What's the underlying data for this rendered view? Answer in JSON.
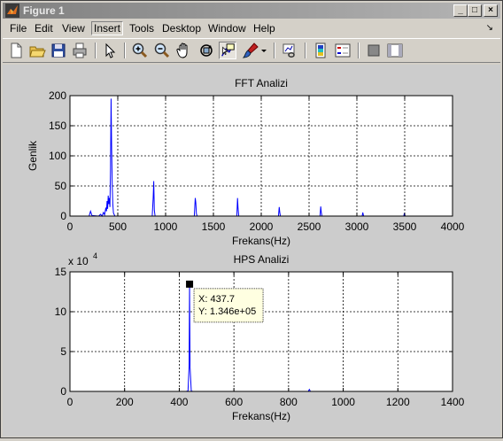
{
  "window": {
    "title": "Figure 1"
  },
  "title_buttons": {
    "minimize": "_",
    "maximize": "□",
    "close": "×"
  },
  "menu": {
    "items": [
      "File",
      "Edit",
      "View",
      "Insert",
      "Tools",
      "Desktop",
      "Window",
      "Help"
    ],
    "active": "Insert",
    "right_icon": "dock-arrow-icon"
  },
  "toolbar": {
    "icons": [
      "new-figure-icon",
      "open-file-icon",
      "save-icon",
      "print-icon",
      "edit-plot-arrow-icon",
      "zoom-in-icon",
      "zoom-out-icon",
      "pan-hand-icon",
      "rotate-3d-icon",
      "data-cursor-icon",
      "brush-icon",
      "brush-dropdown-icon",
      "link-plot-icon",
      "colorbar-icon",
      "legend-icon",
      "hide-plot-tools-icon",
      "show-plot-tools-icon"
    ]
  },
  "colors": {
    "plot_line": "#0000ff",
    "figure_bg": "#cccccc",
    "axes_bg": "#ffffff",
    "datatip_bg": "#ffffe1"
  },
  "chart_data": [
    {
      "type": "line",
      "title": "FFT Analizi",
      "xlabel": "Frekans(Hz)",
      "ylabel": "Genlik",
      "xlim": [
        0,
        4000
      ],
      "ylim": [
        0,
        200
      ],
      "xticks": [
        0,
        500,
        1000,
        1500,
        2000,
        2500,
        3000,
        3500,
        4000
      ],
      "yticks": [
        0,
        50,
        100,
        150,
        200
      ],
      "grid": true,
      "series": [
        {
          "values": [
            [
              0,
              0
            ],
            [
              200,
              0
            ],
            [
              215,
              8
            ],
            [
              230,
              1
            ],
            [
              300,
              0
            ],
            [
              320,
              3
            ],
            [
              335,
              0
            ],
            [
              350,
              6
            ],
            [
              362,
              2
            ],
            [
              375,
              14
            ],
            [
              382,
              8
            ],
            [
              388,
              25
            ],
            [
              394,
              12
            ],
            [
              400,
              34
            ],
            [
              406,
              20
            ],
            [
              412,
              30
            ],
            [
              418,
              15
            ],
            [
              424,
              80
            ],
            [
              430,
              195
            ],
            [
              436,
              110
            ],
            [
              442,
              50
            ],
            [
              448,
              20
            ],
            [
              455,
              5
            ],
            [
              470,
              0
            ],
            [
              860,
              0
            ],
            [
              870,
              30
            ],
            [
              876,
              58
            ],
            [
              882,
              10
            ],
            [
              890,
              0
            ],
            [
              1300,
              0
            ],
            [
              1310,
              30
            ],
            [
              1316,
              22
            ],
            [
              1322,
              4
            ],
            [
              1330,
              0
            ],
            [
              1745,
              0
            ],
            [
              1752,
              30
            ],
            [
              1758,
              12
            ],
            [
              1765,
              0
            ],
            [
              2180,
              0
            ],
            [
              2188,
              15
            ],
            [
              2194,
              6
            ],
            [
              2200,
              0
            ],
            [
              2615,
              0
            ],
            [
              2622,
              16
            ],
            [
              2628,
              6
            ],
            [
              2635,
              0
            ],
            [
              3055,
              0
            ],
            [
              3062,
              6
            ],
            [
              3070,
              0
            ],
            [
              3490,
              0
            ],
            [
              3497,
              5
            ],
            [
              3505,
              0
            ],
            [
              4000,
              0
            ]
          ]
        }
      ]
    },
    {
      "type": "line",
      "title": "HPS Analizi",
      "xlabel": "Frekans(Hz)",
      "yscale_label_base": "x 10",
      "yscale_label_exp": "4",
      "xlim": [
        0,
        1400
      ],
      "ylim": [
        0,
        15
      ],
      "xticks": [
        0,
        200,
        400,
        600,
        800,
        1000,
        1200,
        1400
      ],
      "yticks": [
        0,
        5,
        10,
        15
      ],
      "grid": true,
      "series": [
        {
          "values": [
            [
              0,
              0
            ],
            [
              425,
              0
            ],
            [
              432,
              0.05
            ],
            [
              436,
              3.2
            ],
            [
              437.7,
              13.46
            ],
            [
              439.5,
              3.0
            ],
            [
              444,
              0.05
            ],
            [
              450,
              0
            ],
            [
              872,
              0
            ],
            [
              876,
              0.25
            ],
            [
              880,
              0
            ],
            [
              1330,
              0
            ]
          ]
        }
      ],
      "datatip": {
        "x": 437.7,
        "y": 13.46,
        "line1": "X: 437.7",
        "line2": "Y: 1.346e+05"
      }
    }
  ]
}
